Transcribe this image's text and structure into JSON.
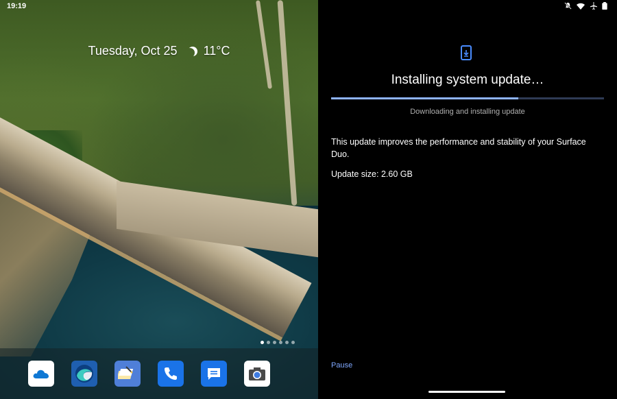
{
  "status": {
    "time": "19:19",
    "icons": [
      "notifications-off-icon",
      "wifi-icon",
      "airplane-mode-icon",
      "battery-icon"
    ]
  },
  "home": {
    "date": "Tuesday, Oct 25",
    "weather_icon": "moon-icon",
    "temperature": "11°C",
    "pages": 6,
    "active_page": 1,
    "dock_apps": [
      {
        "name": "OneDrive",
        "icon": "onedrive-icon",
        "color": "#ffffff"
      },
      {
        "name": "Edge",
        "icon": "edge-icon",
        "color": "#1f5fb0"
      },
      {
        "name": "Notes",
        "icon": "notes-icon",
        "color": "#4f7fd8"
      },
      {
        "name": "Phone",
        "icon": "phone-icon",
        "color": "#1a73e8"
      },
      {
        "name": "Messages",
        "icon": "messages-icon",
        "color": "#1a73e8"
      },
      {
        "name": "Camera",
        "icon": "camera-icon",
        "color": "#ffffff"
      }
    ]
  },
  "update": {
    "icon": "phone-download-icon",
    "title": "Installing system update…",
    "progress": 0.685,
    "progress_text": "Downloading and installing update",
    "description": "This update improves the performance and stability of your Surface Duo.",
    "size": "Update size: 2.60 GB",
    "pause_label": "Pause"
  },
  "colors": {
    "accent": "#4a8cff",
    "progress_fill": "#8fb4ff",
    "progress_track": "#2f3b55",
    "link": "#7fa8ff"
  }
}
